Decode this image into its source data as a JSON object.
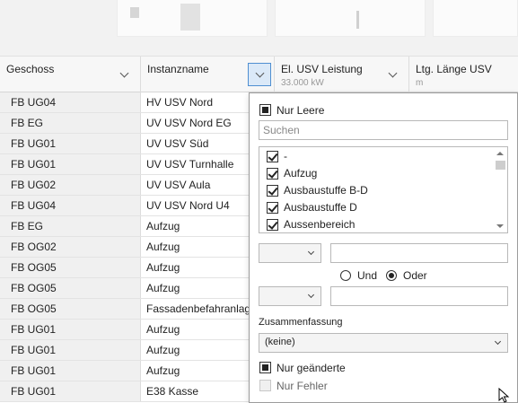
{
  "grid": {
    "columns": [
      {
        "label": "Geschoss",
        "sub": ""
      },
      {
        "label": "Instanzname",
        "sub": ""
      },
      {
        "label": "El. USV Leistung",
        "sub": "33.000 kW"
      },
      {
        "label": "Ltg. Länge USV",
        "sub": "m"
      }
    ],
    "rows": [
      {
        "geschoss": "FB UG04",
        "instanzname": "HV USV Nord"
      },
      {
        "geschoss": "FB EG",
        "instanzname": "UV USV Nord EG"
      },
      {
        "geschoss": "FB UG01",
        "instanzname": "UV USV Süd"
      },
      {
        "geschoss": "FB UG01",
        "instanzname": "UV USV Turnhalle"
      },
      {
        "geschoss": "FB UG02",
        "instanzname": "UV USV Aula"
      },
      {
        "geschoss": "FB UG04",
        "instanzname": "UV USV Nord U4"
      },
      {
        "geschoss": "FB EG",
        "instanzname": "Aufzug"
      },
      {
        "geschoss": "FB OG02",
        "instanzname": "Aufzug"
      },
      {
        "geschoss": "FB OG05",
        "instanzname": "Aufzug"
      },
      {
        "geschoss": "FB OG05",
        "instanzname": "Aufzug"
      },
      {
        "geschoss": "FB OG05",
        "instanzname": "Fassadenbefahranlage"
      },
      {
        "geschoss": "FB UG01",
        "instanzname": "Aufzug"
      },
      {
        "geschoss": "FB UG01",
        "instanzname": "Aufzug"
      },
      {
        "geschoss": "FB UG01",
        "instanzname": "Aufzug"
      },
      {
        "geschoss": "FB UG01",
        "instanzname": "E38 Kasse"
      }
    ]
  },
  "filter_popup": {
    "only_empty_label": "Nur Leere",
    "search_placeholder": "Suchen",
    "values": [
      {
        "label": "-",
        "checked": true
      },
      {
        "label": "Aufzug",
        "checked": true
      },
      {
        "label": "Ausbaustuffe B-D",
        "checked": true
      },
      {
        "label": "Ausbaustuffe D",
        "checked": true
      },
      {
        "label": "Aussenbereich",
        "checked": true
      }
    ],
    "and_label": "Und",
    "or_label": "Oder",
    "selected_logic": "Oder",
    "summary_label": "Zusammenfassung",
    "summary_value": "(keine)",
    "only_changed_label": "Nur geänderte",
    "only_errors_label": "Nur Fehler"
  },
  "colors": {
    "accent": "#4f8fd1",
    "header_bg": "#f7f7f7",
    "first_col_bg": "#f0f0f0"
  }
}
